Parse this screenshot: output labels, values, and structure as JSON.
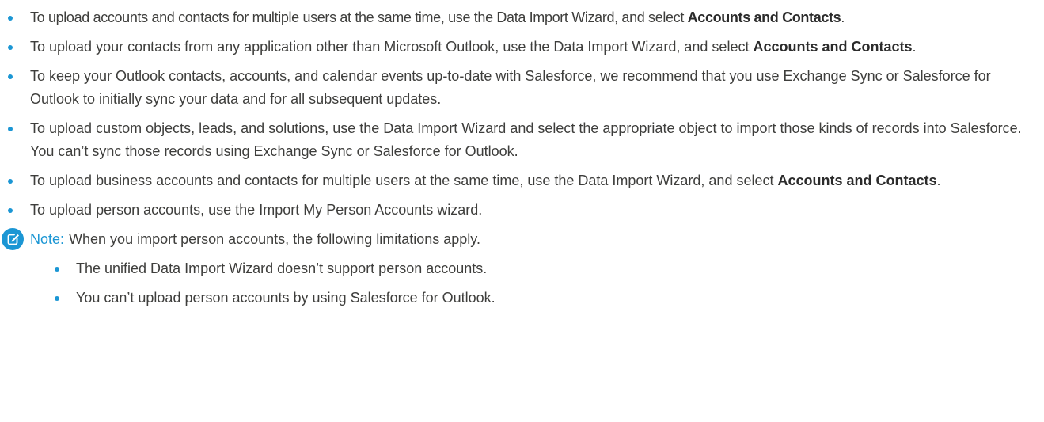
{
  "colors": {
    "accent": "#1b96d4",
    "text": "#3e3e3c"
  },
  "bullets": [
    {
      "before": "To upload accounts and contacts for multiple users at the same time, use the Data Import Wizard, and select ",
      "bold": "Accounts and Contacts",
      "after": "."
    },
    {
      "before": "To upload your contacts from any application other than Microsoft Outlook, use the Data Import Wizard, and select ",
      "bold": "Accounts and Contacts",
      "after": "."
    },
    {
      "text": "To keep your Outlook contacts, accounts, and calendar events up-to-date with Salesforce, we recommend that you use Exchange Sync or Salesforce for Outlook to initially sync your data and for all subsequent updates."
    },
    {
      "text": "To upload custom objects, leads, and solutions, use the Data Import Wizard and select the appropriate object to import those kinds of records into Salesforce. You can’t sync those records using Exchange Sync or Salesforce for Outlook."
    },
    {
      "before": "To upload business accounts and contacts for multiple users at the same time, use the Data Import Wizard, and select ",
      "bold": "Accounts and Contacts",
      "after": "."
    },
    {
      "text": "To upload person accounts, use the Import My Person Accounts wizard."
    }
  ],
  "note": {
    "icon": "edit-note-icon",
    "label": "Note:",
    "text": "When you import person accounts, the following limitations apply.",
    "items": [
      "The unified Data Import Wizard doesn’t support person accounts.",
      "You can’t upload person accounts by using Salesforce for Outlook."
    ]
  }
}
